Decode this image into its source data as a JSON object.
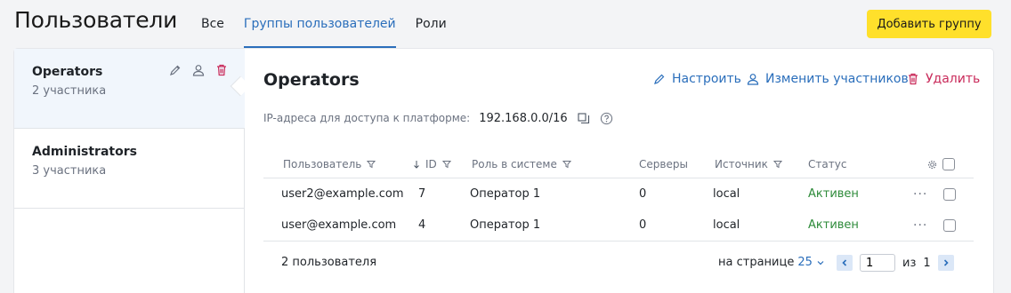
{
  "header": {
    "title": "Пользователи",
    "tabs": [
      {
        "label": "Все",
        "active": false
      },
      {
        "label": "Группы пользователей",
        "active": true
      },
      {
        "label": "Роли",
        "active": false
      }
    ],
    "add_button": "Добавить группу"
  },
  "colors": {
    "accent": "#2a6ebb",
    "primary_button": "#ffe02b",
    "danger": "#c92a5a",
    "status_ok": "#2e8b3a"
  },
  "groups": [
    {
      "name": "Operators",
      "count": "2 участника",
      "selected": true,
      "icons": [
        "pencil-icon",
        "user-icon",
        "trash-icon"
      ]
    },
    {
      "name": "Administrators",
      "count": "3 участника",
      "selected": false
    }
  ],
  "detail": {
    "title": "Operators",
    "actions": {
      "edit": "Настроить",
      "members": "Изменить участников",
      "delete": "Удалить"
    },
    "ip_label": "IP-адреса для доступа к платформе:",
    "ip_value": "192.168.0.0/16"
  },
  "table": {
    "columns": [
      "Пользователь",
      "ID",
      "Роль в системе",
      "Серверы",
      "Источник",
      "Статус"
    ],
    "rows": [
      {
        "user": "user2@example.com",
        "id": "7",
        "role": "Оператор 1",
        "servers": "0",
        "source": "local",
        "status": "Активен"
      },
      {
        "user": "user@example.com",
        "id": "4",
        "role": "Оператор 1",
        "servers": "0",
        "source": "local",
        "status": "Активен"
      }
    ]
  },
  "footer": {
    "total": "2 пользователя",
    "per_page_label": "на странице",
    "per_page_value": "25",
    "page": "1",
    "of_label": "из",
    "pages": "1"
  }
}
